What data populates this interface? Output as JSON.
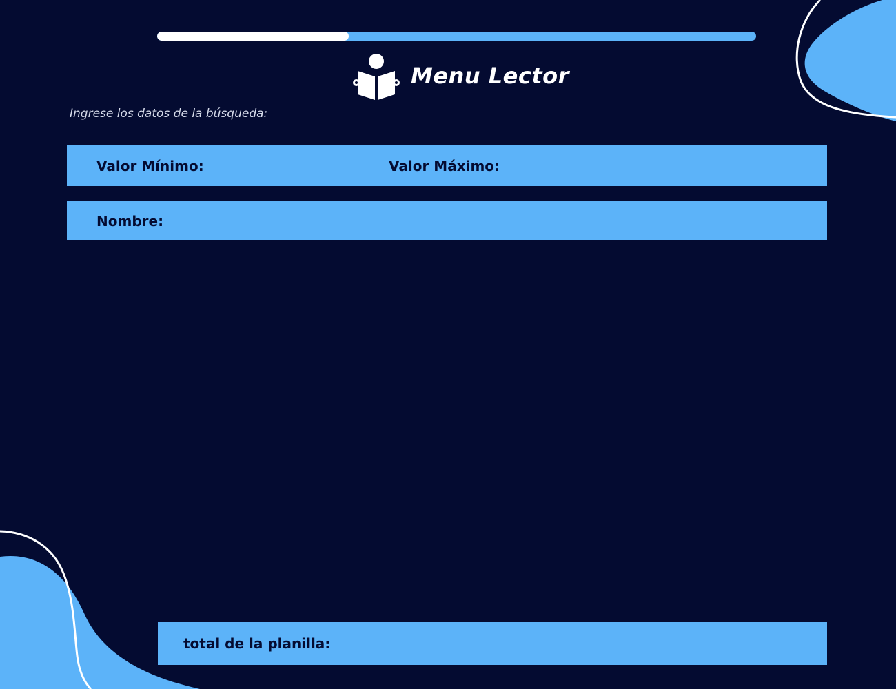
{
  "app": {
    "title": "Menu Lector",
    "icon": "reader-icon"
  },
  "progress": {
    "value": 0.32
  },
  "search": {
    "instructions": "Ingrese los datos de la búsqueda:",
    "min_label": "Valor Mínimo:",
    "min_value": "",
    "max_label": "Valor Máximo:",
    "max_value": "",
    "name_label": "Nombre:",
    "name_value": ""
  },
  "total": {
    "label": "total de la planilla:",
    "value": ""
  },
  "colors": {
    "background": "#040b31",
    "accent": "#5cb3f9",
    "text_light": "#ffffff",
    "text_dark": "#040b31",
    "progress_fill": "#ffffff"
  }
}
